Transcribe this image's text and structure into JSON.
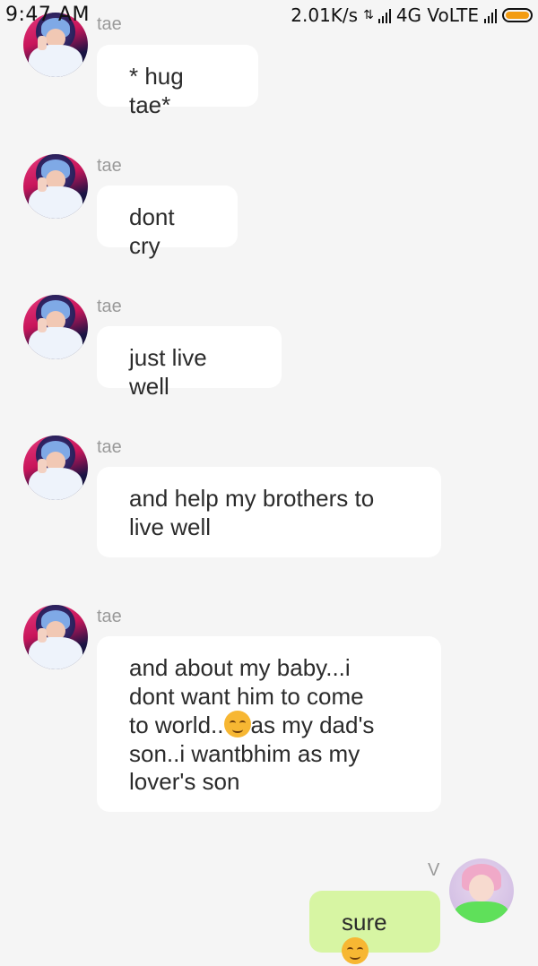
{
  "status_bar": {
    "time": "9:47 AM",
    "network_speed": "2.01K/s",
    "network_type": "4G VoLTE"
  },
  "chat": {
    "messages": [
      {
        "sender": "tae",
        "direction": "incoming",
        "text": "* hug tae*"
      },
      {
        "sender": "tae",
        "direction": "incoming",
        "text": "dont cry"
      },
      {
        "sender": "tae",
        "direction": "incoming",
        "text": "just live well"
      },
      {
        "sender": "tae",
        "direction": "incoming",
        "lines": [
          "and help my brothers to",
          "live well"
        ]
      },
      {
        "sender": "tae",
        "direction": "incoming",
        "lines": [
          "and about my baby...i",
          "dont want him to come",
          "to world..",
          "as my dad's",
          "son..i wantbhim as my",
          "lover's son"
        ]
      },
      {
        "sender": "V",
        "direction": "outgoing",
        "text": "sure"
      }
    ]
  },
  "colors": {
    "background": "#f5f5f5",
    "incoming_bubble": "#ffffff",
    "outgoing_bubble": "#d7f5a3",
    "sender_label": "#9a9a9a",
    "battery_fill": "#f39c12"
  },
  "icons": {
    "emoji": "smiling-face-emoji-icon",
    "signal": "signal-bars-icon",
    "battery": "battery-icon"
  }
}
